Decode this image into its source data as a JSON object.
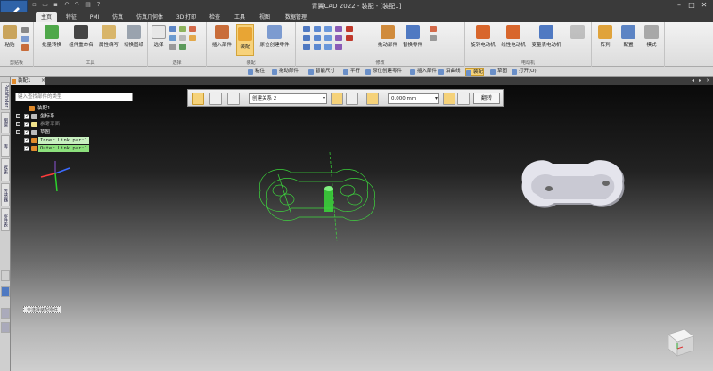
{
  "window": {
    "title": "青翼CAD 2022 - 装配 - [装配1]",
    "controls": [
      "–",
      "□",
      "✕"
    ]
  },
  "tabs": [
    "主页",
    "特征",
    "PMI",
    "仿真",
    "仿真几何体",
    "3D 打印",
    "检查",
    "工具",
    "视图",
    "数据管理"
  ],
  "ribbon": {
    "groups": [
      {
        "label": "剪贴板",
        "buttons": [
          "粘贴"
        ]
      },
      {
        "label": "工具",
        "buttons": [
          "批量转换",
          "组件重命名",
          "属性编写",
          "切换图纸"
        ]
      },
      {
        "label": "选择",
        "buttons": [
          "选择"
        ]
      },
      {
        "label": "装配",
        "buttons": [
          "插入部件",
          "装配",
          "原位创建零件"
        ]
      },
      {
        "label": "修改",
        "buttons": [
          "拖动部件",
          "替换零件"
        ]
      },
      {
        "label": "电动机",
        "buttons": [
          "旋转电动机",
          "线性电动机",
          "变量表电动机"
        ]
      },
      {
        "label": "",
        "buttons": [
          "阵列",
          "配置",
          "模式"
        ]
      }
    ]
  },
  "command_bar": [
    "粘住",
    "拖动部件",
    "智能尺寸",
    "平行",
    "原位创建零件",
    "插入部件",
    "沿曲线",
    "装配",
    "草图",
    "打开(O)"
  ],
  "document": {
    "tab": "装配1"
  },
  "left_dock": [
    "Pathfinder",
    "图层",
    "库",
    "族表",
    "传感器",
    "零件表"
  ],
  "search": {
    "placeholder": "键入查找部件的类型"
  },
  "tree": {
    "root": "装配1",
    "items": [
      "坐标系",
      "参考平面",
      "草图",
      "Inner Link.par:1",
      "Outer Link.par:1"
    ]
  },
  "relation_toolbar": {
    "relation": "创建关系 2",
    "offset": "0.000 mm",
    "flip_label": "翻转"
  },
  "status": {
    "text": "未选择装配零件"
  },
  "colors": {
    "ribbon_active": "#f7d27b",
    "selected_part": "#3ee83e",
    "app_blue": "#2f63a8"
  }
}
